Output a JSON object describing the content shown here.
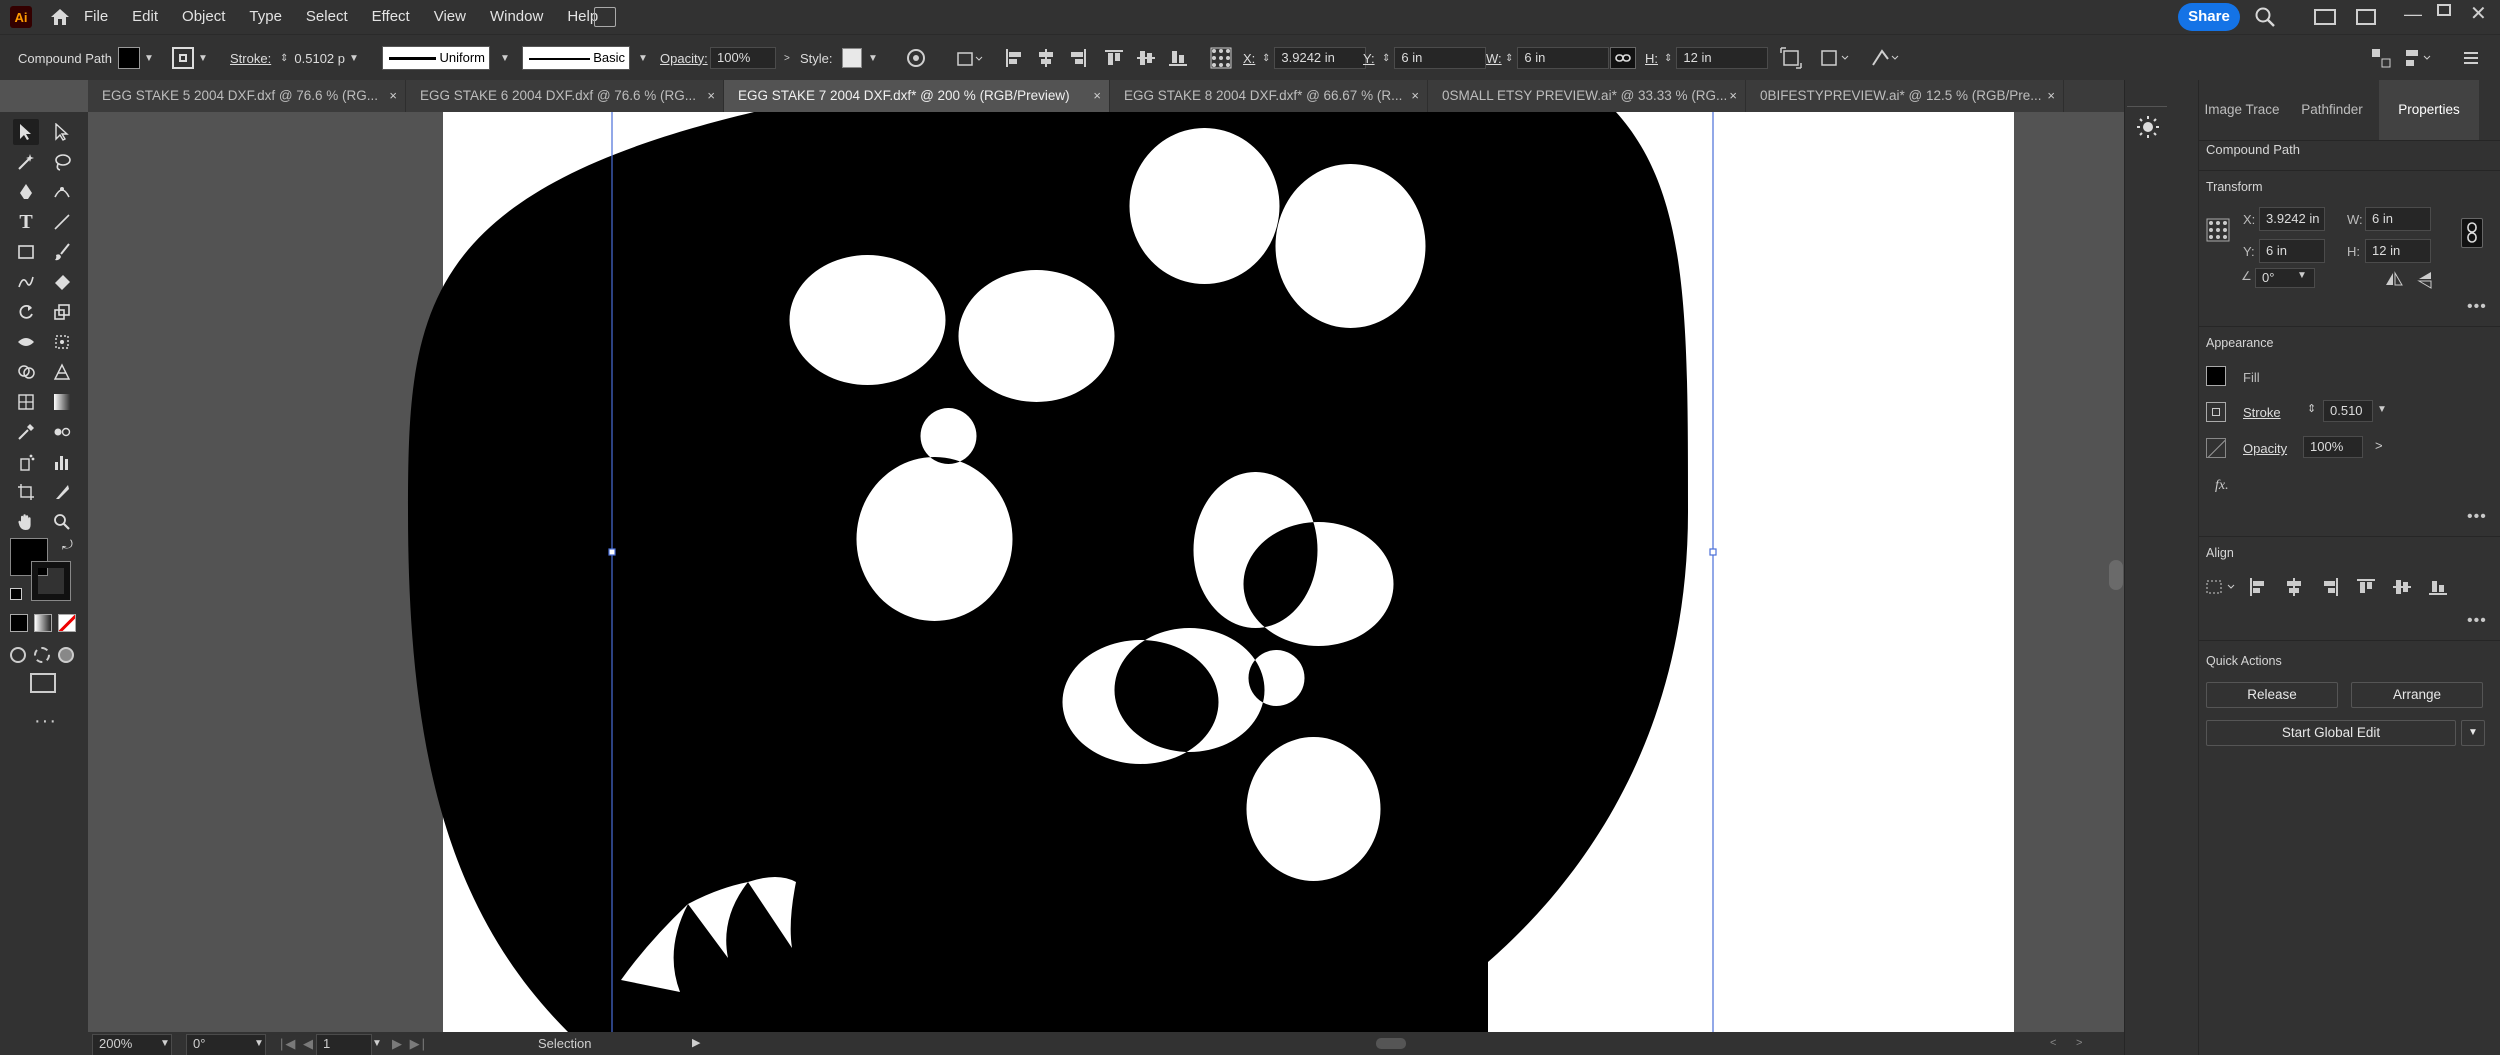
{
  "app": {
    "logo": "Ai",
    "home_icon": "home-icon"
  },
  "menu": [
    "File",
    "Edit",
    "Object",
    "Type",
    "Select",
    "Effect",
    "View",
    "Window",
    "Help"
  ],
  "menubar_right": {
    "share": "Share"
  },
  "control": {
    "object_type": "Compound Path",
    "stroke_label": "Stroke:",
    "stroke_value": "0.5102 p",
    "profile_uniform": "Uniform",
    "brush_basic": "Basic",
    "opacity_label": "Opacity:",
    "opacity_value": "100%",
    "style_label": "Style:",
    "x_label": "X:",
    "x_value": "3.9242 in",
    "y_label": "Y:",
    "y_value": "6 in",
    "w_label": "W:",
    "w_value": "6 in",
    "h_label": "H:",
    "h_value": "12 in"
  },
  "tabs": [
    {
      "label": "EGG STAKE 5 2004 DXF.dxf @ 76.6 % (RG...",
      "active": false
    },
    {
      "label": "EGG STAKE 6 2004 DXF.dxf @ 76.6 % (RG...",
      "active": false
    },
    {
      "label": "EGG STAKE 7 2004 DXF.dxf* @ 200 % (RGB/Preview)",
      "active": true
    },
    {
      "label": "EGG STAKE 8 2004 DXF.dxf* @ 66.67 % (R...",
      "active": false
    },
    {
      "label": "0SMALL ETSY PREVIEW.ai* @ 33.33 % (RG...",
      "active": false
    },
    {
      "label": "0BIFESTYPREVIEW.ai* @ 12.5 % (RGB/Pre...",
      "active": false
    }
  ],
  "tab_close": "×",
  "panel": {
    "tabs": [
      "Image Trace",
      "Pathfinder",
      "Properties"
    ],
    "object_type": "Compound Path",
    "transform": {
      "title": "Transform",
      "x_label": "X:",
      "x": "3.9242 in",
      "y_label": "Y:",
      "y": "6 in",
      "w_label": "W:",
      "w": "6 in",
      "h_label": "H:",
      "h": "12 in",
      "angle": "0°"
    },
    "appearance": {
      "title": "Appearance",
      "fill": "Fill",
      "stroke": "Stroke",
      "stroke_value": "0.510",
      "opacity": "Opacity",
      "opacity_value": "100%",
      "fx": "fx."
    },
    "align": {
      "title": "Align"
    },
    "quick_actions": {
      "title": "Quick Actions",
      "release": "Release",
      "arrange": "Arrange",
      "global_edit": "Start Global Edit"
    }
  },
  "status": {
    "zoom": "200%",
    "rotation": "0°",
    "artboard": "1",
    "tool": "Selection"
  },
  "colors": {
    "accent": "#1473e6",
    "selection": "#4a6fd8",
    "panel_bg": "#323232",
    "canvas_bg": "#535353"
  }
}
